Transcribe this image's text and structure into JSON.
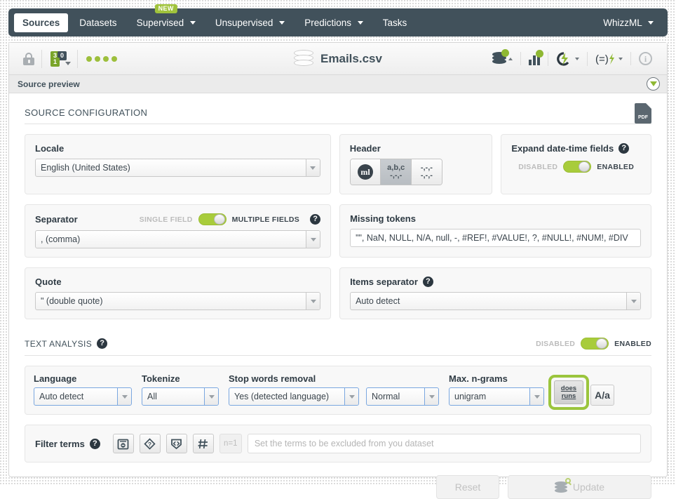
{
  "nav": {
    "items": [
      {
        "label": "Sources",
        "active": true,
        "caret": false,
        "badge": null
      },
      {
        "label": "Datasets",
        "active": false,
        "caret": false,
        "badge": null
      },
      {
        "label": "Supervised",
        "active": false,
        "caret": true,
        "badge": "NEW"
      },
      {
        "label": "Unsupervised",
        "active": false,
        "caret": true,
        "badge": null
      },
      {
        "label": "Predictions",
        "active": false,
        "caret": true,
        "badge": null
      },
      {
        "label": "Tasks",
        "active": false,
        "caret": false,
        "badge": null
      }
    ],
    "right_item": {
      "label": "WhizzML",
      "caret": true
    }
  },
  "resource_bar": {
    "lock_icon": "lock-icon",
    "fields_counts": {
      "numeric": "3",
      "text": "0",
      "categorical": "1"
    },
    "status_dots": 4,
    "title": "Emails.csv",
    "actions": [
      {
        "name": "dataset-action",
        "icon": "database-gear-icon"
      },
      {
        "name": "chart-action",
        "icon": "bar-chart-gear-icon"
      },
      {
        "name": "batch-action",
        "icon": "lightning-icon"
      },
      {
        "name": "script-action",
        "icon": "script-lightning-icon"
      },
      {
        "name": "info-action",
        "icon": "info-icon"
      }
    ]
  },
  "preview_bar": {
    "title": "Source preview"
  },
  "source_configuration": {
    "title": "SOURCE CONFIGURATION",
    "export_icon_label": "PDF",
    "locale": {
      "label": "Locale",
      "value": "English (United States)"
    },
    "header": {
      "label": "Header",
      "options": [
        {
          "name": "auto",
          "top": "ml",
          "bottom": ""
        },
        {
          "name": "with-header",
          "top": "a,b,c",
          "bottom": "-,-,-"
        },
        {
          "name": "no-header",
          "top": "-,-,-",
          "bottom": "-,-,-"
        }
      ],
      "selected_index": 1
    },
    "expand_datetime": {
      "label": "Expand date-time fields",
      "off_label": "DISABLED",
      "on_label": "ENABLED",
      "enabled": true
    },
    "separator": {
      "label": "Separator",
      "value": ", (comma)",
      "off_label": "SINGLE FIELD",
      "on_label": "MULTIPLE FIELDS",
      "enabled": true
    },
    "missing_tokens": {
      "label": "Missing tokens",
      "value": "\"\", NaN, NULL, N/A, null, -, #REF!, #VALUE!, ?, #NULL!, #NUM!, #DIV"
    },
    "quote": {
      "label": "Quote",
      "value": "\" (double quote)"
    },
    "items_separator": {
      "label": "Items separator",
      "value": "Auto detect"
    }
  },
  "text_analysis": {
    "title": "TEXT ANALYSIS",
    "off_label": "DISABLED",
    "on_label": "ENABLED",
    "enabled": true,
    "language": {
      "label": "Language",
      "value": "Auto detect"
    },
    "tokenize": {
      "label": "Tokenize",
      "value": "All"
    },
    "stop_words": {
      "label": "Stop words removal",
      "value": "Yes (detected language)",
      "strength": "Normal"
    },
    "max_ngrams": {
      "label": "Max. n-grams",
      "value": "unigram"
    },
    "stemming_button": {
      "line1": "does",
      "line2": "runs",
      "highlighted": true
    },
    "case_button": {
      "label": "A/a"
    }
  },
  "filter_terms": {
    "label": "Filter terms",
    "icons": [
      {
        "name": "stopwords-filter-icon"
      },
      {
        "name": "unknown-terms-filter-icon"
      },
      {
        "name": "html-tags-filter-icon"
      },
      {
        "name": "numeric-terms-filter-icon"
      }
    ],
    "ngram_badge": "n=1",
    "input_placeholder": "Set the terms to be excluded from you dataset",
    "input_value": ""
  },
  "footer": {
    "reset_label": "Reset",
    "update_label": "Update",
    "reset_disabled": true,
    "update_disabled": true
  },
  "colors": {
    "nav_bg": "#41515b",
    "accent_green": "#a0c33c",
    "highlight_ring": "#9bc53d",
    "text_dark": "#2f3b44"
  }
}
